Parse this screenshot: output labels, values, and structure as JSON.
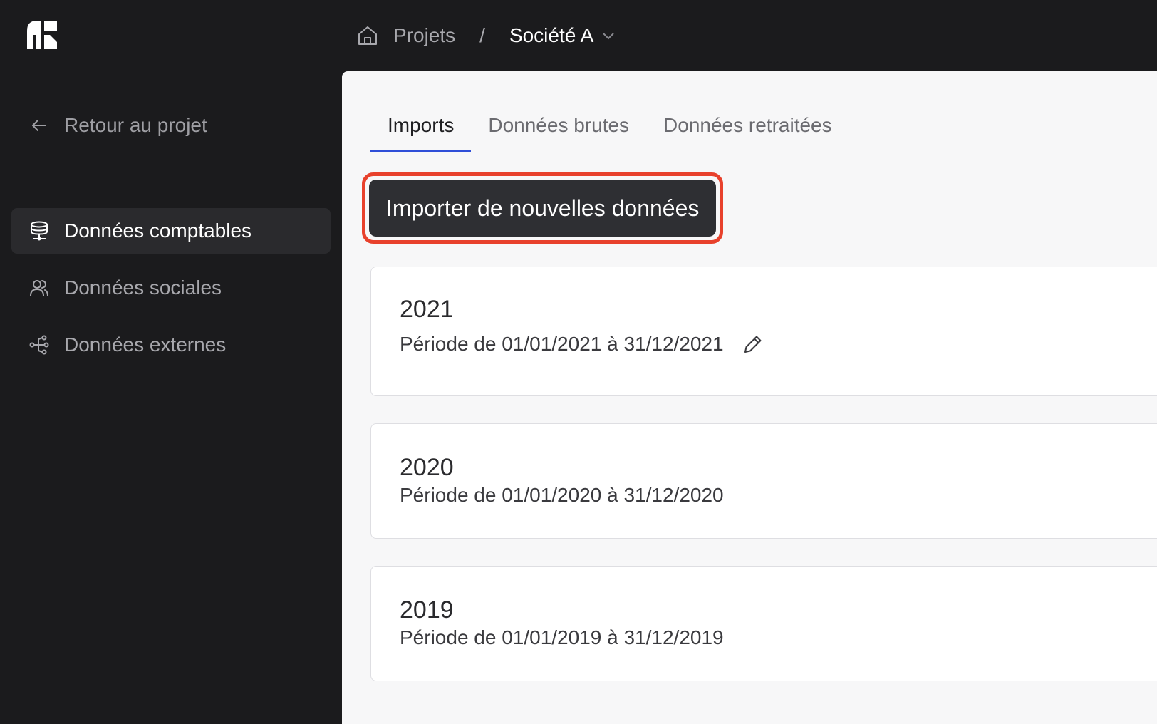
{
  "breadcrumb": {
    "home_icon": "home-icon",
    "projects": "Projets",
    "separator": "/",
    "current": "Société A"
  },
  "sidebar": {
    "back": "Retour au projet",
    "items": [
      {
        "label": "Données comptables",
        "icon": "database-icon",
        "active": true
      },
      {
        "label": "Données sociales",
        "icon": "users-icon",
        "active": false
      },
      {
        "label": "Données externes",
        "icon": "share-nodes-icon",
        "active": false
      }
    ]
  },
  "tabs": [
    "Imports",
    "Données brutes",
    "Données retraitées"
  ],
  "import_button": "Importer de nouvelles données",
  "imports": [
    {
      "year": "2021",
      "period": "Période de 01/01/2021 à 31/12/2021"
    },
    {
      "year": "2020",
      "period": "Période de 01/01/2020 à 31/12/2020"
    },
    {
      "year": "2019",
      "period": "Période de 01/01/2019 à 31/12/2019"
    }
  ],
  "colors": {
    "sidebar_bg": "#1b1b1d",
    "accent": "#2f4fd8",
    "highlight": "#e8412c",
    "button_bg": "#2e2f33"
  }
}
